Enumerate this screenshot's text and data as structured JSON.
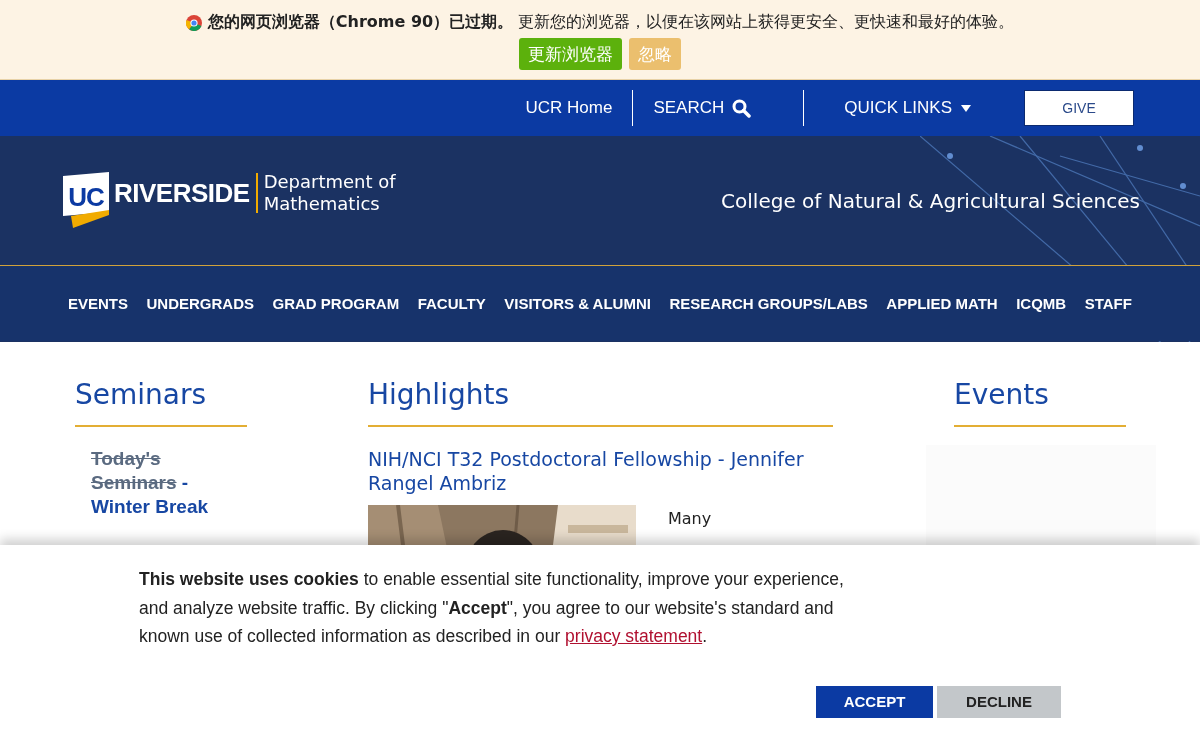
{
  "browser_notice": {
    "message": "**您的网页浏览器（Chrome 90）已过期。** 更新您的浏览器，以便在该网站上获得更安全、更快速和最好的体验。",
    "buttons": [
      {
        "label": "更新浏览器",
        "kind": "primary"
      },
      {
        "label": "忽略",
        "kind": "secondary"
      }
    ]
  },
  "utility_nav": {
    "items": [
      {
        "label": "UCR Home",
        "kind": "link"
      },
      {
        "label": "SEARCH",
        "kind": "search"
      },
      {
        "label": "QUICK LINKS",
        "kind": "dropdown"
      }
    ],
    "give_button": "GIVE"
  },
  "header": {
    "logo_mark": "UC",
    "logo_word": "RIVERSIDE",
    "department": [
      "Department of",
      "Mathematics"
    ],
    "college": "College of Natural & Agricultural Sciences"
  },
  "main_nav": [
    "EVENTS",
    "UNDERGRADS",
    "GRAD PROGRAM",
    "FACULTY",
    "VISITORS & ALUMNI",
    "RESEARCH GROUPS/LABS",
    "APPLIED MATH",
    "ICQMB",
    "STAFF"
  ],
  "seminars": {
    "heading": "Seminars",
    "link": {
      "struck": "Today's Seminars",
      "text": " - Winter Break"
    }
  },
  "highlights": {
    "heading": "Highlights",
    "article": {
      "title": "NIH/NCI T32 Postdoctoral Fellowship - Jennifer Rangel Ambriz",
      "excerpt": "Many"
    }
  },
  "events": {
    "heading": "Events"
  },
  "cookie_banner": {
    "text": "**This website uses cookies** to enable essential site functionality, improve your experience, and analyze website traffic. By clicking \"**Accept**\", you agree to our website's standard and known use of collected information as described in our ",
    "link": "privacy statement",
    "end": ".",
    "buttons": [
      {
        "label": "ACCEPT",
        "kind": "primary"
      },
      {
        "label": "DECLINE",
        "kind": "secondary"
      }
    ]
  }
}
